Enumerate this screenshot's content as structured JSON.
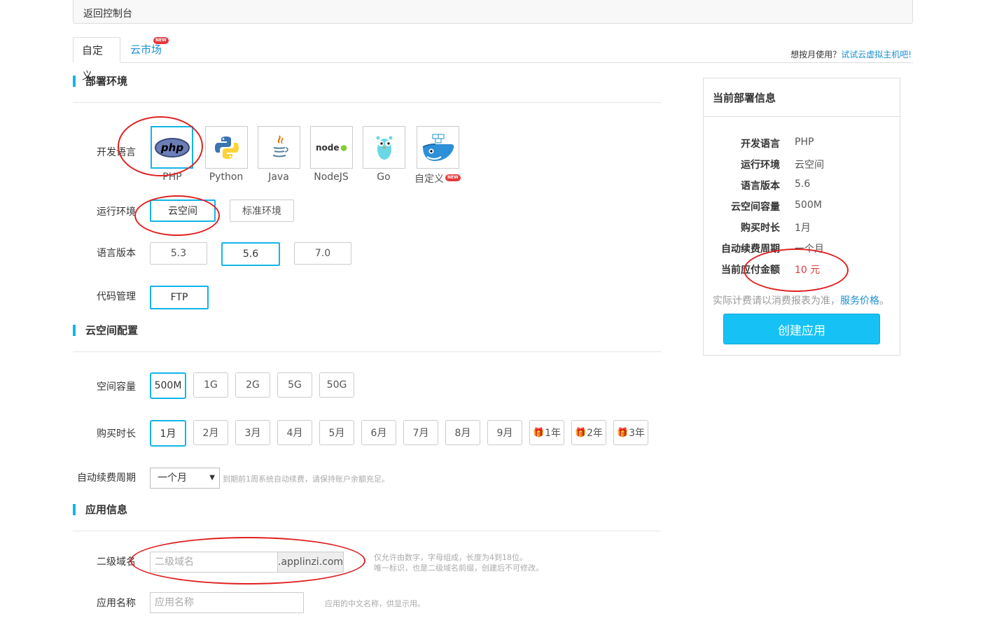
{
  "topbar": {
    "back_label": "返回控制台"
  },
  "tabs": {
    "custom": "自定义",
    "market": "云市场",
    "new_badge": "NEW"
  },
  "hint": {
    "prefix": "想按月使用？",
    "link": "试试云虚拟主机吧!"
  },
  "sections": {
    "deploy_env": "部署环境",
    "space_config": "云空间配置",
    "app_info": "应用信息"
  },
  "deploy": {
    "lang_label": "开发语言",
    "languages": [
      {
        "name": "PHP",
        "icon": "php-logo-icon"
      },
      {
        "name": "Python",
        "icon": "python-logo-icon"
      },
      {
        "name": "Java",
        "icon": "java-logo-icon"
      },
      {
        "name": "NodeJS",
        "icon": "nodejs-logo-icon"
      },
      {
        "name": "Go",
        "icon": "go-gopher-icon"
      },
      {
        "name": "自定义",
        "icon": "docker-whale-icon"
      }
    ],
    "runtime_label": "运行环境",
    "runtimes": [
      "云空间",
      "标准环境"
    ],
    "version_label": "语言版本",
    "versions": [
      "5.3",
      "5.6",
      "7.0"
    ],
    "code_label": "代码管理",
    "code_options": [
      "FTP"
    ]
  },
  "space": {
    "capacity_label": "空间容量",
    "capacities": [
      "500M",
      "1G",
      "2G",
      "5G",
      "50G"
    ],
    "duration_label": "购买时长",
    "durations": [
      "1月",
      "2月",
      "3月",
      "4月",
      "5月",
      "6月",
      "7月",
      "8月",
      "9月",
      "1年",
      "2年",
      "3年"
    ],
    "renew_label": "自动续费周期",
    "renew_value": "一个月",
    "renew_help": "到期前1周系统自动续费，请保持账户余额充足。"
  },
  "app": {
    "domain_label": "二级域名",
    "domain_placeholder": "二级域名",
    "domain_suffix": ".applinzi.com",
    "domain_help_1": "仅允许由数字，字母组成，长度为4到18位。",
    "domain_help_2": "唯一标识，也是二级域名前缀，创建后不可修改。",
    "name_label": "应用名称",
    "name_placeholder": "应用名称",
    "name_help": "应用的中文名称，供显示用。"
  },
  "summary": {
    "title": "当前部署信息",
    "rows": [
      {
        "k": "开发语言",
        "v": "PHP"
      },
      {
        "k": "运行环境",
        "v": "云空间"
      },
      {
        "k": "语言版本",
        "v": "5.6"
      },
      {
        "k": "云空间容量",
        "v": "500M"
      },
      {
        "k": "购买时长",
        "v": "1月"
      },
      {
        "k": "自动续费周期",
        "v": "一个月"
      },
      {
        "k": "当前应付金额",
        "v": "10 元"
      }
    ],
    "note": "实际计费请以消费报表为准，",
    "note_link": "服务价格",
    "note_end": "。",
    "create_label": "创建应用"
  },
  "colors": {
    "accent": "#13b5e6",
    "link": "#1a8fd6",
    "price": "#e4393c",
    "button": "#16c2f5",
    "annotation": "#e02020"
  }
}
